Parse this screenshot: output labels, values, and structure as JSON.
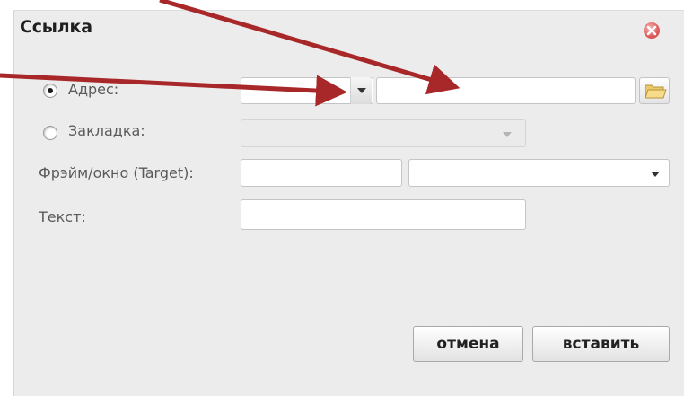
{
  "dialog": {
    "title": "Ссылка",
    "close_icon": "close-x-icon"
  },
  "fields": {
    "address_label": "Адрес:",
    "address_selected": true,
    "address_protocol": "",
    "address_url": "",
    "browse_icon": "folder-icon",
    "bookmark_label": "Закладка:",
    "bookmark_selected": false,
    "bookmark_value": "",
    "target_label": "Фрэйм/окно (Target):",
    "target_name": "",
    "target_select": "",
    "text_label": "Текст:",
    "text_value": ""
  },
  "buttons": {
    "cancel": "отмена",
    "insert": "вставить"
  },
  "annotations": {
    "arrow_color": "#a8282a",
    "arrow_icons": [
      "arrow-to-protocol-dropdown",
      "arrow-to-url-field"
    ]
  }
}
